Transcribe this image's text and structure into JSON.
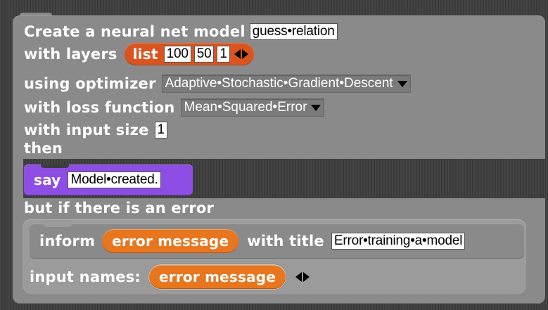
{
  "block": {
    "create_label": "Create a neural net model",
    "model_name": "guess•relation",
    "layers_label": "with layers",
    "list_label": "list",
    "layers": [
      "100",
      "50",
      "1"
    ],
    "optimizer_label": "using optimizer",
    "optimizer_value": "Adaptive•Stochastic•Gradient•Descent",
    "loss_label": "with loss function",
    "loss_value": "Mean•Squared•Error",
    "input_size_label": "with input size",
    "input_size_value": "1",
    "then_label": "then"
  },
  "say": {
    "label": "say",
    "message": "Model•created."
  },
  "error_handler": {
    "label": "but if there is an error",
    "inform_label": "inform",
    "error_var": "error message",
    "with_title_label": "with title",
    "title_value": "Error•training•a•model",
    "input_names_label": "input names:",
    "input_name_var": "error message"
  },
  "colors": {
    "control_block": "#8a8a8a",
    "list_reporter": "#d9541f",
    "looks_block": "#8e4ee6",
    "variable_reporter": "#e8761e",
    "background": "#3d3d3d"
  },
  "icons": {
    "dropdown": "triangle-down",
    "expand_arrows": "left-right-arrows"
  }
}
